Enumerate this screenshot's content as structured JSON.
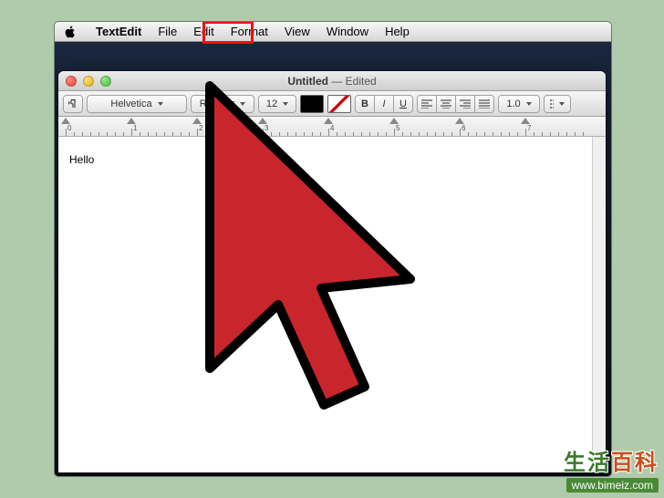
{
  "menubar": {
    "app_name": "TextEdit",
    "items": [
      "File",
      "Edit",
      "Format",
      "View",
      "Window",
      "Help"
    ],
    "highlighted_index": 1
  },
  "window": {
    "title_main": "Untitled",
    "title_suffix": " — Edited"
  },
  "toolbar": {
    "font_family": "Helvetica",
    "font_style": "Regular",
    "font_size": "12",
    "bold_label": "B",
    "italic_label": "I",
    "underline_label": "U",
    "line_spacing": "1.0"
  },
  "ruler": {
    "ticks": [
      "0",
      "1",
      "2",
      "3",
      "4",
      "5",
      "6",
      "7"
    ]
  },
  "document": {
    "body": "Hello"
  },
  "watermark": {
    "cn_part1": "生活",
    "cn_part2": "百科",
    "url": "www.bimeiz.com"
  }
}
